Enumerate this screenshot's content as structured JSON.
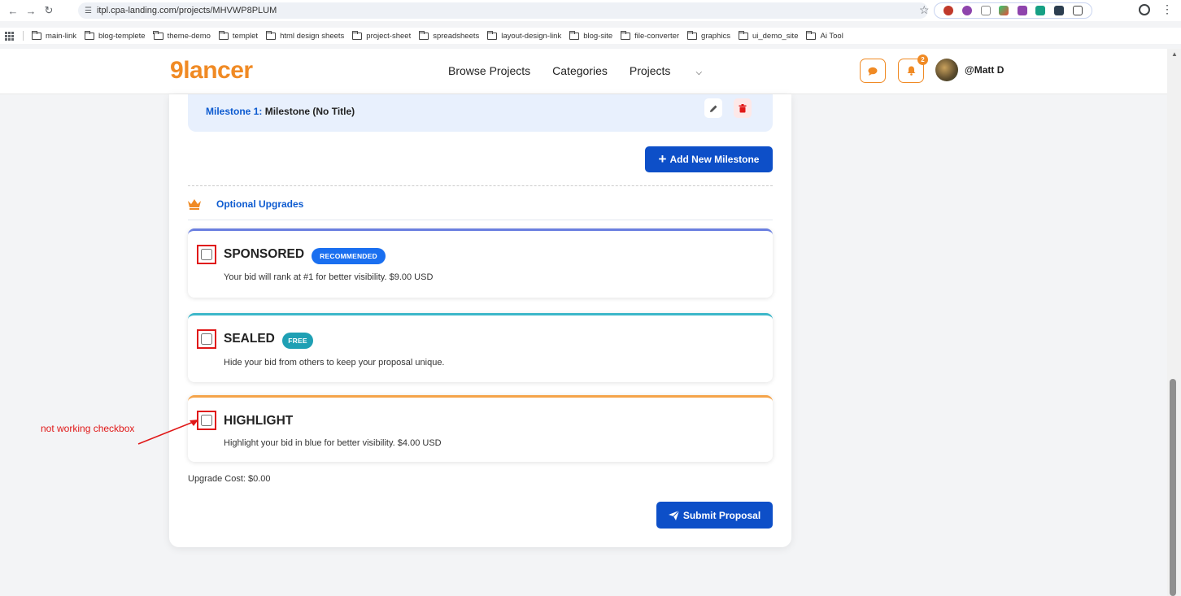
{
  "browser": {
    "url": "itpl.cpa-landing.com/projects/MHVWP8PLUM",
    "bookmarks": [
      "main-link",
      "blog-templete",
      "theme-demo",
      "templet",
      "html design sheets",
      "project-sheet",
      "spreadsheets",
      "layout-design-link",
      "blog-site",
      "file-converter",
      "graphics",
      "ui_demo_site",
      "Ai Tool"
    ]
  },
  "header": {
    "logo_nine": "9",
    "logo_text": "lancer",
    "nav": {
      "browse": "Browse Projects",
      "categories": "Categories",
      "projects": "Projects"
    },
    "notification_count": "2",
    "username": "@Matt D"
  },
  "milestone": {
    "number_label": "Milestone 1:",
    "title": "Milestone (No Title)"
  },
  "add_milestone_label": "Add New Milestone",
  "optional_upgrades_title": "Optional Upgrades",
  "upgrades": [
    {
      "title": "SPONSORED",
      "badge": "RECOMMENDED",
      "description": "Your bid will rank at #1 for better visibility. $9.00 USD",
      "checked": false,
      "accent": "#6a7fe0",
      "badge_color": "#1a6ff0"
    },
    {
      "title": "SEALED",
      "badge": "FREE",
      "description": "Hide your bid from others to keep your proposal unique.",
      "checked": false,
      "accent": "#3cb7c9",
      "badge_color": "#1fa0b4"
    },
    {
      "title": "HIGHLIGHT",
      "badge": "",
      "description": "Highlight your bid in blue for better visibility. $4.00 USD",
      "checked": false,
      "accent": "#f5a44a"
    }
  ],
  "upgrade_cost": "Upgrade Cost: $0.00",
  "submit_label": "Submit Proposal",
  "annotation_text": "not working checkbox",
  "colors": {
    "brand_orange": "#f08a24",
    "primary_blue": "#0d4fc8",
    "annotation_red": "#e01818"
  }
}
